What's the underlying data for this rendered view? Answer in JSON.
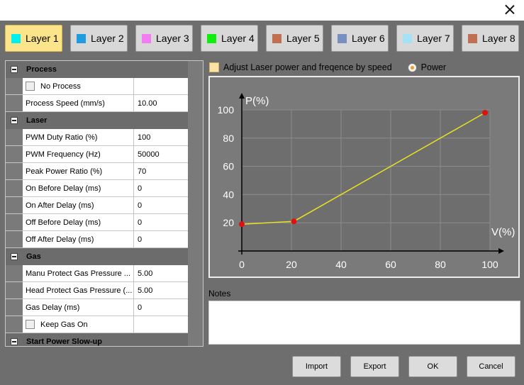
{
  "layers": [
    {
      "label": "Layer 1",
      "color": "#00f0f0",
      "active": true
    },
    {
      "label": "Layer 2",
      "color": "#1e9ce0"
    },
    {
      "label": "Layer 3",
      "color": "#f37cf3"
    },
    {
      "label": "Layer 4",
      "color": "#10ee10"
    },
    {
      "label": "Layer 5",
      "color": "#c07050"
    },
    {
      "label": "Layer 6",
      "color": "#7890c0"
    },
    {
      "label": "Layer 7",
      "color": "#a6e2f6"
    },
    {
      "label": "Layer 8",
      "color": "#c07050"
    }
  ],
  "params": {
    "process": {
      "title": "Process",
      "no_process": "No Process",
      "speed_label": "Process Speed (mm/s)",
      "speed_value": "10.00"
    },
    "laser": {
      "title": "Laser",
      "rows": [
        {
          "label": "PWM Duty Ratio (%)",
          "value": "100"
        },
        {
          "label": "PWM Frequency (Hz)",
          "value": "50000"
        },
        {
          "label": "Peak Power Ratio (%)",
          "value": "70"
        },
        {
          "label": "On Before Delay (ms)",
          "value": "0"
        },
        {
          "label": "On After Delay (ms)",
          "value": "0"
        },
        {
          "label": "Off Before Delay (ms)",
          "value": "0"
        },
        {
          "label": "Off After Delay (ms)",
          "value": "0"
        }
      ]
    },
    "gas": {
      "title": "Gas",
      "rows": [
        {
          "label": "Manu Protect Gas Pressure ...",
          "value": "5.00"
        },
        {
          "label": "Head Protect Gas Pressure (...",
          "value": "5.00"
        },
        {
          "label": "Gas Delay (ms)",
          "value": "0"
        }
      ],
      "keep_gas_on": "Keep Gas On"
    },
    "slowup": {
      "title": "Start Power Slow-up"
    }
  },
  "options": {
    "adjust_label": "Adjust Laser power and freqence by speed",
    "power_label": "Power"
  },
  "chart_data": {
    "type": "line",
    "ylabel": "P(%)",
    "xlabel": "V(%)",
    "x_ticks": [
      0,
      20,
      40,
      60,
      80,
      100
    ],
    "y_ticks": [
      20,
      40,
      60,
      80,
      100
    ],
    "xlim": [
      0,
      100
    ],
    "ylim": [
      0,
      100
    ],
    "grid": true,
    "points": [
      {
        "x": 0,
        "y": 19
      },
      {
        "x": 21,
        "y": 21
      },
      {
        "x": 98,
        "y": 98
      }
    ],
    "line_color": "#e8e020",
    "point_color": "#e01010"
  },
  "notes": {
    "label": "Notes",
    "value": ""
  },
  "buttons": {
    "import": "Import",
    "export": "Export",
    "ok": "OK",
    "cancel": "Cancel"
  }
}
